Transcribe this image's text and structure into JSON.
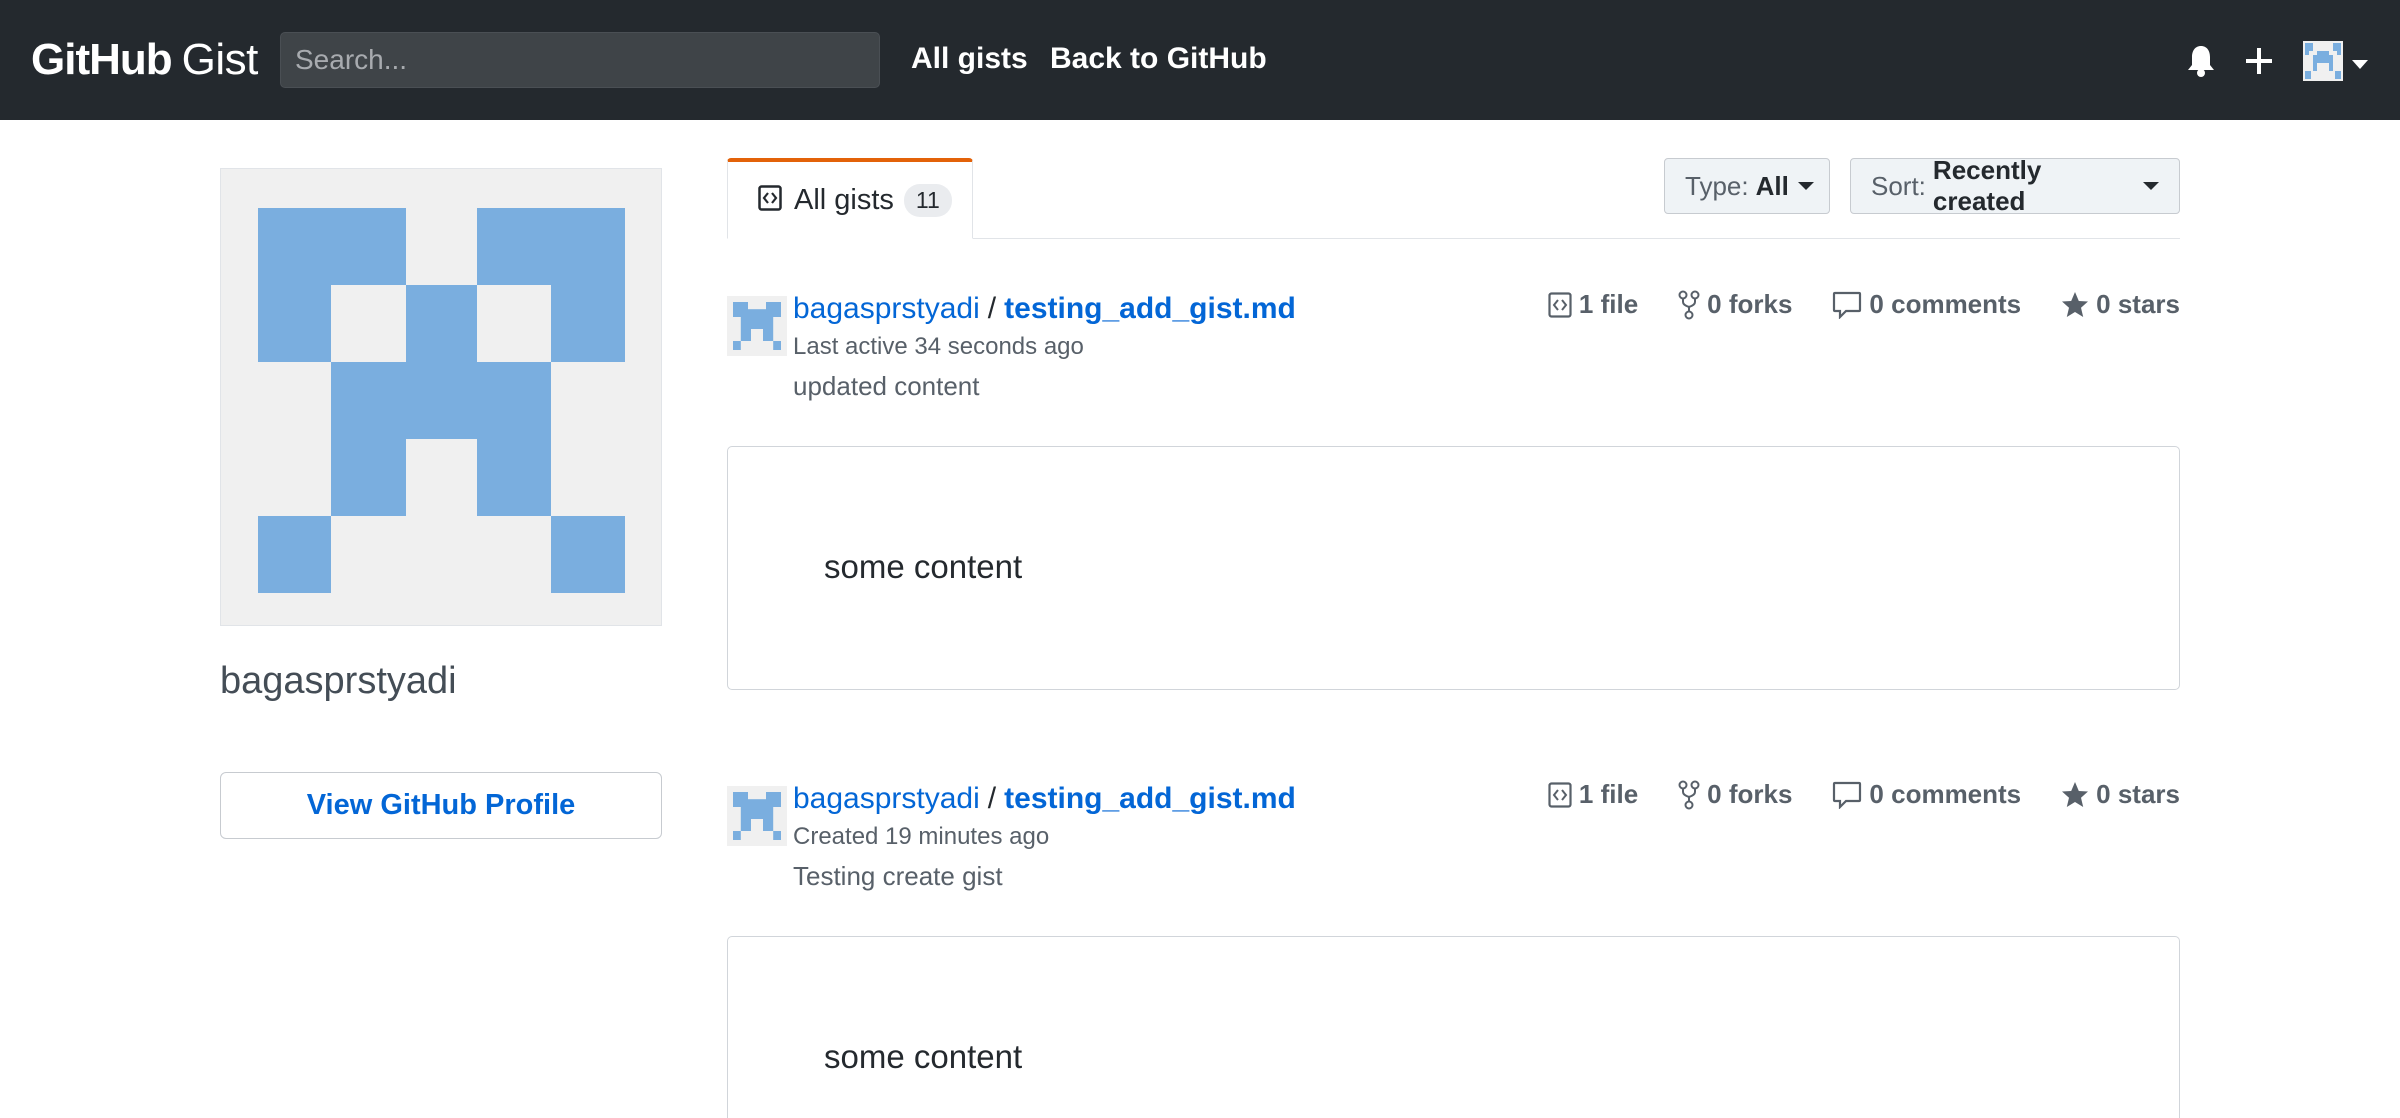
{
  "header": {
    "logo_github": "GitHub",
    "logo_gist": "Gist",
    "search_placeholder": "Search...",
    "nav": [
      "All gists",
      "Back to GitHub"
    ],
    "icons": [
      "bell-icon",
      "plus-icon",
      "avatar-icon",
      "caret-down-icon"
    ]
  },
  "sidebar": {
    "username": "bagasprstyadi",
    "profile_button": "View GitHub Profile"
  },
  "tabs": [
    {
      "label": "All gists",
      "count": "11",
      "icon": "code-square-icon"
    }
  ],
  "filters": {
    "type_label": "Type:",
    "type_value": "All",
    "sort_label": "Sort:",
    "sort_value": "Recently created"
  },
  "gists": [
    {
      "owner": "bagasprstyadi",
      "separator": "/",
      "filename": "testing_add_gist.md",
      "meta": "Last active 34 seconds ago",
      "description": "updated content",
      "files": "1 file",
      "forks": "0 forks",
      "comments": "0 comments",
      "stars": "0 stars",
      "content": "some content"
    },
    {
      "owner": "bagasprstyadi",
      "separator": "/",
      "filename": "testing_add_gist.md",
      "meta": "Created 19 minutes ago",
      "description": "Testing create gist",
      "files": "1 file",
      "forks": "0 forks",
      "comments": "0 comments",
      "stars": "0 stars",
      "content": "some content"
    }
  ],
  "colors": {
    "header_bg": "#24292e",
    "link": "#0366d6",
    "tab_accent": "#e36209",
    "identicon": "#7aaedf"
  }
}
